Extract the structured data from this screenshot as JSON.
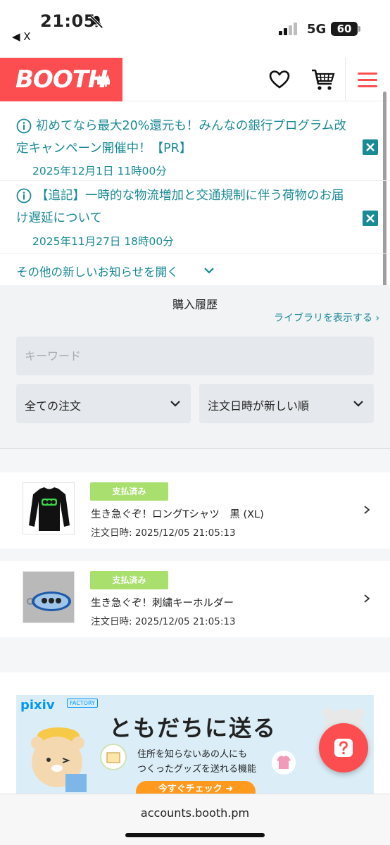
{
  "status_bar": {
    "time": "21:05",
    "back_label": "◀ X",
    "network": "5G",
    "battery": "60"
  },
  "header": {
    "logo": "BOOTH"
  },
  "notices": [
    {
      "text": "初めてなら最大20%還元も！みんなの銀行プログラム改定キャンペーン開催中！【PR】",
      "date": "2025年12月1日 11時00分"
    },
    {
      "text": "【追記】一時的な物流増加と交通規制に伴う荷物のお届け遅延について",
      "date": "2025年11月27日 18時00分"
    }
  ],
  "more_notices_label": "その他の新しいお知らせを開く",
  "history": {
    "title": "購入履歴",
    "library_link": "ライブラリを表示する ›",
    "keyword_placeholder": "キーワード",
    "filter_order": "全ての注文",
    "sort_order": "注文日時が新しい順"
  },
  "orders": [
    {
      "status": "支払済み",
      "title": "生き急ぐぞ！ロングTシャツ　黒 (XL)",
      "date": "注文日時: 2025/12/05 21:05:13"
    },
    {
      "status": "支払済み",
      "title": "生き急ぐぞ！刺繍キーホルダー",
      "date": "注文日時: 2025/12/05 21:05:13"
    }
  ],
  "banner": {
    "brand": "pixiv",
    "tag": "FACTORY",
    "title": "ともだちに送る",
    "line1": "住所を知らないあの人にも",
    "line2": "つくったグッズを送れる機能",
    "cta": "今すぐチェック ➜"
  },
  "browser": {
    "url": "accounts.booth.pm"
  },
  "colors": {
    "brand": "#fc4d50",
    "link": "#1a8a95",
    "paid_badge": "#a8df6d"
  }
}
